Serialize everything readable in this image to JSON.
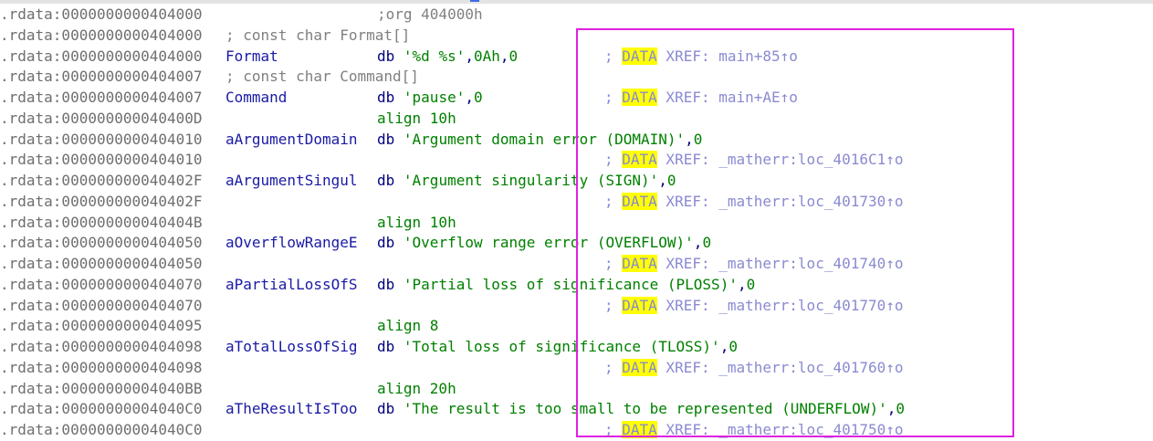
{
  "highlight_colors": {
    "search": "#ffff00",
    "selection_frame": "#e020e0"
  },
  "lines": [
    {
      "addr": ".rdata:0000000000404000",
      "label": "",
      "parts": [
        {
          "t": ";org 404000h",
          "c": "c-gray"
        }
      ],
      "comment": "",
      "comment_hl": "",
      "comment_rest": ""
    },
    {
      "addr": ".rdata:0000000000404000",
      "label": "; const char Format[]",
      "parts": [],
      "comment": "",
      "comment_hl": "",
      "comment_rest": "",
      "label_gray": true
    },
    {
      "addr": ".rdata:0000000000404000",
      "label": "Format",
      "parts": [
        {
          "t": "db ",
          "c": "c-op"
        },
        {
          "t": "'%d %s'",
          "c": "c-str"
        },
        {
          "t": ",",
          "c": "c-op"
        },
        {
          "t": "0Ah",
          "c": "c-num"
        },
        {
          "t": ",",
          "c": "c-op"
        },
        {
          "t": "0",
          "c": "c-num"
        }
      ],
      "comment": "; ",
      "comment_hl": "DATA",
      "comment_rest": " XREF: main+85↑o"
    },
    {
      "addr": ".rdata:0000000000404007",
      "label": "; const char Command[]",
      "parts": [],
      "comment": "",
      "comment_hl": "",
      "comment_rest": "",
      "label_gray": true
    },
    {
      "addr": ".rdata:0000000000404007",
      "label": "Command",
      "parts": [
        {
          "t": "db ",
          "c": "c-op"
        },
        {
          "t": "'pause'",
          "c": "c-str"
        },
        {
          "t": ",",
          "c": "c-op"
        },
        {
          "t": "0",
          "c": "c-num"
        }
      ],
      "comment": "; ",
      "comment_hl": "DATA",
      "comment_rest": " XREF: main+AE↑o"
    },
    {
      "addr": ".rdata:000000000040400D",
      "label": "",
      "parts": [
        {
          "t": "align 10h",
          "c": "c-dir"
        }
      ],
      "comment": "",
      "comment_hl": "",
      "comment_rest": ""
    },
    {
      "addr": ".rdata:0000000000404010",
      "label": "aArgumentDomain",
      "parts": [
        {
          "t": "db ",
          "c": "c-op"
        },
        {
          "t": "'Argument domain error (DOMAIN)'",
          "c": "c-str"
        },
        {
          "t": ",",
          "c": "c-op"
        },
        {
          "t": "0",
          "c": "c-num"
        }
      ],
      "comment": "",
      "comment_hl": "",
      "comment_rest": ""
    },
    {
      "addr": ".rdata:0000000000404010",
      "label": "",
      "parts": [],
      "comment": "; ",
      "comment_hl": "DATA",
      "comment_rest": " XREF: _matherr:loc_4016C1↑o"
    },
    {
      "addr": ".rdata:000000000040402F",
      "label": "aArgumentSingul",
      "parts": [
        {
          "t": "db ",
          "c": "c-op"
        },
        {
          "t": "'Argument singularity (SIGN)'",
          "c": "c-str"
        },
        {
          "t": ",",
          "c": "c-op"
        },
        {
          "t": "0",
          "c": "c-num"
        }
      ],
      "comment": "",
      "comment_hl": "",
      "comment_rest": ""
    },
    {
      "addr": ".rdata:000000000040402F",
      "label": "",
      "parts": [],
      "comment": "; ",
      "comment_hl": "DATA",
      "comment_rest": " XREF: _matherr:loc_401730↑o"
    },
    {
      "addr": ".rdata:000000000040404B",
      "label": "",
      "parts": [
        {
          "t": "align 10h",
          "c": "c-dir"
        }
      ],
      "comment": "",
      "comment_hl": "",
      "comment_rest": ""
    },
    {
      "addr": ".rdata:0000000000404050",
      "label": "aOverflowRangeE",
      "parts": [
        {
          "t": "db ",
          "c": "c-op"
        },
        {
          "t": "'Overflow range error (OVERFLOW)'",
          "c": "c-str"
        },
        {
          "t": ",",
          "c": "c-op"
        },
        {
          "t": "0",
          "c": "c-num"
        }
      ],
      "comment": "",
      "comment_hl": "",
      "comment_rest": ""
    },
    {
      "addr": ".rdata:0000000000404050",
      "label": "",
      "parts": [],
      "comment": "; ",
      "comment_hl": "DATA",
      "comment_rest": " XREF: _matherr:loc_401740↑o"
    },
    {
      "addr": ".rdata:0000000000404070",
      "label": "aPartialLossOfS",
      "parts": [
        {
          "t": "db ",
          "c": "c-op"
        },
        {
          "t": "'Partial loss of significance (PLOSS)'",
          "c": "c-str"
        },
        {
          "t": ",",
          "c": "c-op"
        },
        {
          "t": "0",
          "c": "c-num"
        }
      ],
      "comment": "",
      "comment_hl": "",
      "comment_rest": ""
    },
    {
      "addr": ".rdata:0000000000404070",
      "label": "",
      "parts": [],
      "comment": "; ",
      "comment_hl": "DATA",
      "comment_rest": " XREF: _matherr:loc_401770↑o"
    },
    {
      "addr": ".rdata:0000000000404095",
      "label": "",
      "parts": [
        {
          "t": "align 8",
          "c": "c-dir"
        }
      ],
      "comment": "",
      "comment_hl": "",
      "comment_rest": ""
    },
    {
      "addr": ".rdata:0000000000404098",
      "label": "aTotalLossOfSig",
      "parts": [
        {
          "t": "db ",
          "c": "c-op"
        },
        {
          "t": "'Total loss of significance (TLOSS)'",
          "c": "c-str"
        },
        {
          "t": ",",
          "c": "c-op"
        },
        {
          "t": "0",
          "c": "c-num"
        }
      ],
      "comment": "",
      "comment_hl": "",
      "comment_rest": ""
    },
    {
      "addr": ".rdata:0000000000404098",
      "label": "",
      "parts": [],
      "comment": "; ",
      "comment_hl": "DATA",
      "comment_rest": " XREF: _matherr:loc_401760↑o"
    },
    {
      "addr": ".rdata:00000000004040BB",
      "label": "",
      "parts": [
        {
          "t": "align 20h",
          "c": "c-dir"
        }
      ],
      "comment": "",
      "comment_hl": "",
      "comment_rest": ""
    },
    {
      "addr": ".rdata:00000000004040C0",
      "label": "aTheResultIsToo",
      "parts": [
        {
          "t": "db ",
          "c": "c-op"
        },
        {
          "t": "'The result is too small to be represented (UNDERFLOW)'",
          "c": "c-str"
        },
        {
          "t": ",",
          "c": "c-op"
        },
        {
          "t": "0",
          "c": "c-num"
        }
      ],
      "comment": "",
      "comment_hl": "",
      "comment_rest": ""
    },
    {
      "addr": ".rdata:00000000004040C0",
      "label": "",
      "parts": [],
      "comment": "; ",
      "comment_hl": "DATA",
      "comment_rest": " XREF: _matherr:loc_401750↑o"
    }
  ]
}
